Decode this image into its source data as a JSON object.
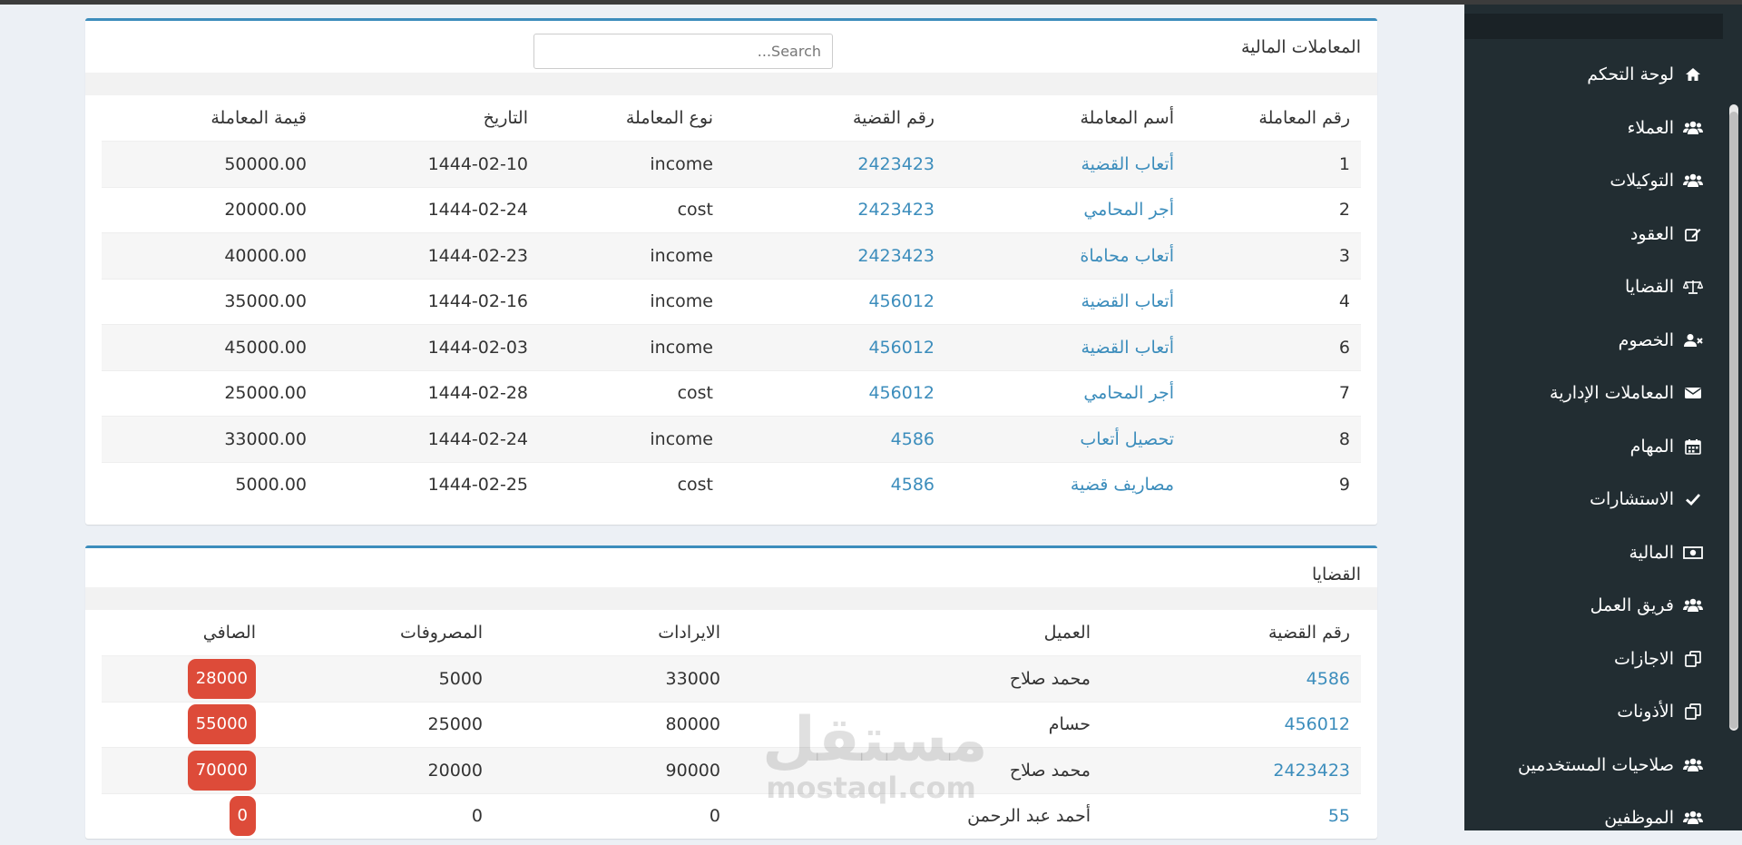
{
  "sidebar": {
    "items": [
      {
        "label": "لوحة التحكم",
        "icon": "home-icon"
      },
      {
        "label": "العملاء",
        "icon": "users-icon"
      },
      {
        "label": "التوكيلات",
        "icon": "users-icon"
      },
      {
        "label": "العقود",
        "icon": "edit-icon"
      },
      {
        "label": "القضايا",
        "icon": "balance-scale-icon"
      },
      {
        "label": "الخصوم",
        "icon": "user-times-icon"
      },
      {
        "label": "المعاملات الإدارية",
        "icon": "envelope-icon"
      },
      {
        "label": "المهام",
        "icon": "calendar-icon"
      },
      {
        "label": "الاستشارات",
        "icon": "check-icon"
      },
      {
        "label": "المالية",
        "icon": "money-icon"
      },
      {
        "label": "فريق العمل",
        "icon": "users-icon"
      },
      {
        "label": "الاجازات",
        "icon": "copy-icon"
      },
      {
        "label": "الأذونات",
        "icon": "copy-icon"
      },
      {
        "label": "صلاحيات المستخدمين",
        "icon": "users-icon"
      },
      {
        "label": "الموظفين",
        "icon": "users-icon"
      }
    ]
  },
  "transactions": {
    "title": "المعاملات المالية",
    "search_placeholder": "Search...",
    "headers": [
      "رقم المعاملة",
      "أسم المعاملة",
      "رقم القضية",
      "نوع المعاملة",
      "التاريخ",
      "قيمة المعاملة"
    ],
    "rows": [
      [
        "1",
        "أتعاب القضية",
        "2423423",
        "income",
        "1444-02-10",
        "50000.00"
      ],
      [
        "2",
        "أجر المحامي",
        "2423423",
        "cost",
        "1444-02-24",
        "20000.00"
      ],
      [
        "3",
        "أتعاب محاماة",
        "2423423",
        "income",
        "1444-02-23",
        "40000.00"
      ],
      [
        "4",
        "أتعاب القضية",
        "456012",
        "income",
        "1444-02-16",
        "35000.00"
      ],
      [
        "6",
        "أتعاب القضية",
        "456012",
        "income",
        "1444-02-03",
        "45000.00"
      ],
      [
        "7",
        "أجر المحامي",
        "456012",
        "cost",
        "1444-02-28",
        "25000.00"
      ],
      [
        "8",
        "تحصيل أتعاب",
        "4586",
        "income",
        "1444-02-24",
        "33000.00"
      ],
      [
        "9",
        "مصاريف قضية",
        "4586",
        "cost",
        "1444-02-25",
        "5000.00"
      ]
    ]
  },
  "cases": {
    "title": "القضايا",
    "headers": [
      "رقم القضية",
      "العميل",
      "الايرادات",
      "المصروفات",
      "الصافي"
    ],
    "rows": [
      [
        "4586",
        "محمد صلاح",
        "33000",
        "5000",
        "28000"
      ],
      [
        "456012",
        "حسام",
        "80000",
        "25000",
        "55000"
      ],
      [
        "2423423",
        "محمد صلاح",
        "90000",
        "20000",
        "70000"
      ],
      [
        "55",
        "أحمد عبد الرحمن",
        "0",
        "0",
        "0"
      ]
    ]
  },
  "watermark": {
    "line1": "مستقل",
    "line2": "mostaql.com"
  },
  "colors": {
    "accent": "#3c8dbc",
    "badge": "#dd4b39",
    "sidebar": "#222d32"
  }
}
